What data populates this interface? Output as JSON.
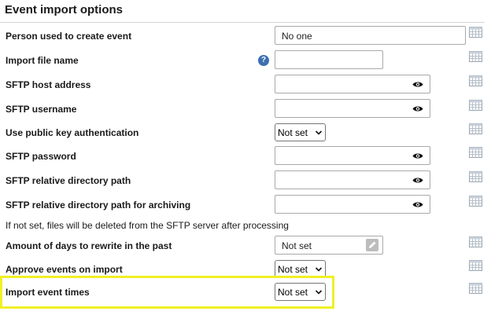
{
  "section": {
    "title": "Event import options"
  },
  "rows": [
    {
      "label": "Person used to create event",
      "value": "No one"
    },
    {
      "label": "Import file name",
      "help_icon": "question-circle-icon",
      "help_glyph": "?"
    },
    {
      "label": "SFTP host address"
    },
    {
      "label": "SFTP username"
    },
    {
      "label": "Use public key authentication",
      "value": "Not set"
    },
    {
      "label": "SFTP password"
    },
    {
      "label": "SFTP relative directory path"
    },
    {
      "label": "SFTP relative directory path for archiving"
    },
    {
      "label": "Amount of days to rewrite in the past",
      "value": "Not set"
    },
    {
      "label": "Approve events on import",
      "value": "Not set"
    },
    {
      "label": "Import event times",
      "value": "Not set"
    }
  ],
  "archive_note": "If not set, files will be deleted from the SFTP server after processing",
  "icons": {
    "reveal": "eye-icon",
    "table": "table-grid-icon",
    "edit": "pencil-icon",
    "dropdown": "chevron-down-icon"
  },
  "colors": {
    "highlight": "#f0f026",
    "help_icon": "#3d6fb2",
    "border": "#a9a9a9"
  }
}
